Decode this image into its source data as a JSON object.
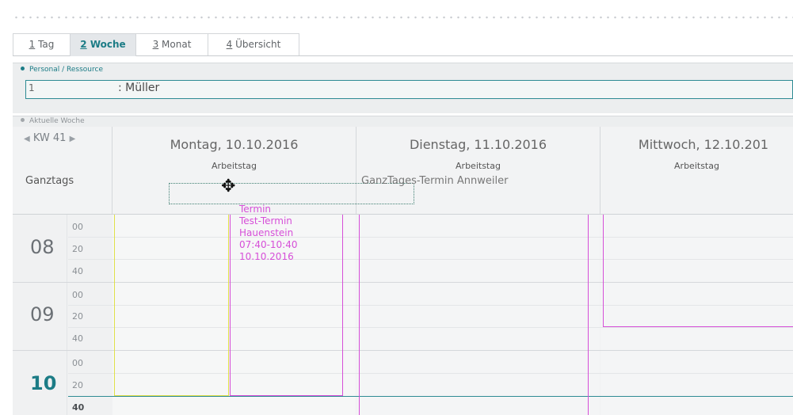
{
  "tabs": [
    {
      "key": "1",
      "label": " Tag"
    },
    {
      "key": "2",
      "label": " Woche"
    },
    {
      "key": "3",
      "label": " Monat"
    },
    {
      "key": "4",
      "label": " Übersicht"
    }
  ],
  "resource_panel": {
    "title": "Personal / Ressource",
    "id": "1",
    "value": ": Müller"
  },
  "week_panel": {
    "title": "Aktuelle Woche",
    "week": "KW 41",
    "allday_label": "Ganztags"
  },
  "days": [
    {
      "date": "Montag, 10.10.2016",
      "type": "Arbeitstag"
    },
    {
      "date": "Dienstag, 11.10.2016",
      "type": "Arbeitstag"
    },
    {
      "date": "Mittwoch, 12.10.201",
      "type": "Arbeitstag"
    }
  ],
  "allday_event": "GanzTages-Termin Annweiler",
  "hours": [
    {
      "hour": "08",
      "minutes": [
        "00",
        "20",
        "40"
      ]
    },
    {
      "hour": "09",
      "minutes": [
        "00",
        "20",
        "40"
      ]
    },
    {
      "hour": "10",
      "minutes": [
        "00",
        "20",
        "40"
      ]
    }
  ],
  "appointment": {
    "lines": [
      "Termin",
      "Test-Termin",
      "Hauenstein",
      "07:40-10:40",
      "10.10.2016"
    ]
  },
  "colors": {
    "accent": "#1c7c86",
    "appointment": "#d64fd8",
    "yellow_line": "#e0e04a"
  }
}
